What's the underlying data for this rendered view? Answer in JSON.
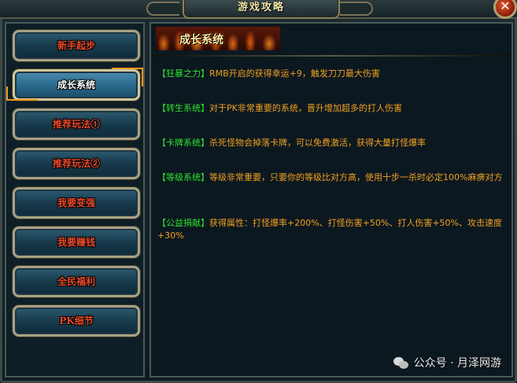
{
  "window": {
    "title": "游戏攻略",
    "close_glyph": "✕"
  },
  "sidebar": {
    "items": [
      {
        "label": "新手起步",
        "style": "red"
      },
      {
        "label": "成长系统",
        "style": "active"
      },
      {
        "label": "推荐玩法①",
        "style": "red"
      },
      {
        "label": "推荐玩法②",
        "style": "red"
      },
      {
        "label": "我要变强",
        "style": "red"
      },
      {
        "label": "我要赚钱",
        "style": "red"
      },
      {
        "label": "全民福利",
        "style": "red"
      },
      {
        "label": "PK细节",
        "style": "red"
      }
    ]
  },
  "content": {
    "title": "成长系统",
    "entries": [
      {
        "tag": "【狂暴之力】",
        "text": "RMB开启的获得幸运+9，触发刀刀最大伤害"
      },
      {
        "tag": "【转生系统】",
        "text": "对于PK非常重要的系统，晋升增加超多的打人伤害"
      },
      {
        "tag": "【卡牌系统】",
        "text": "杀死怪物会掉落卡牌，可以免费激活，获得大量打怪爆率"
      },
      {
        "tag": "【等级系统】",
        "text": "等级非常重要，只要你的等级比对方高，使用十步一杀时必定100%麻痹对方"
      },
      {
        "tag": "【公益捐献】",
        "text": "获得属性：打怪爆率+200%、打怪伤害+50%、打人伤害+50%、攻击速度+30%"
      }
    ]
  },
  "watermark": {
    "text": "公众号 · 月泽网游",
    "icon": "wechat-icon"
  },
  "colors": {
    "tag_green": "#2ee02e",
    "text_orange": "#f0a020",
    "nav_red": "#e84a2a",
    "accent_orange": "#f09a1e"
  }
}
